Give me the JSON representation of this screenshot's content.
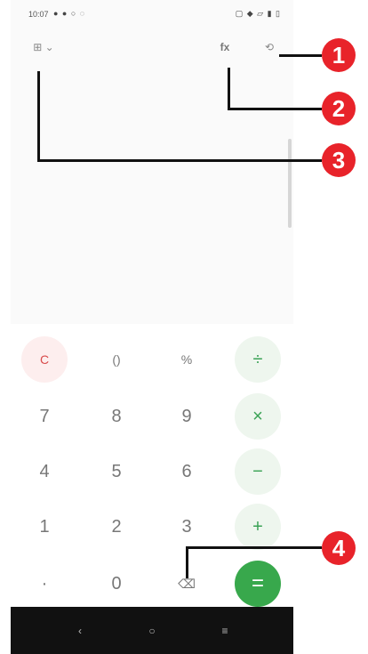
{
  "status": {
    "time": "10:07",
    "left_icons": "● ● ○ ◌",
    "right_icons": "▢ ◆ ▱ ▮ ▯"
  },
  "toolbar": {
    "unit_label": "⊞ ⌄",
    "sci_label": "fx",
    "history_label": "⟲"
  },
  "keypad": {
    "rows": [
      [
        "C",
        "()",
        "%",
        "÷"
      ],
      [
        "7",
        "8",
        "9",
        "×"
      ],
      [
        "4",
        "5",
        "6",
        "−"
      ],
      [
        "1",
        "2",
        "3",
        "+"
      ],
      [
        "·",
        "0",
        "⌫",
        "="
      ]
    ]
  },
  "nav": {
    "back": "‹",
    "home": "○",
    "recents": "≡"
  },
  "callouts": [
    "1",
    "2",
    "3",
    "4"
  ],
  "colors": {
    "accent_green": "#38a84c",
    "clear_red": "#d84b4b",
    "callout_red": "#e8232a",
    "navbar": "#111111"
  }
}
